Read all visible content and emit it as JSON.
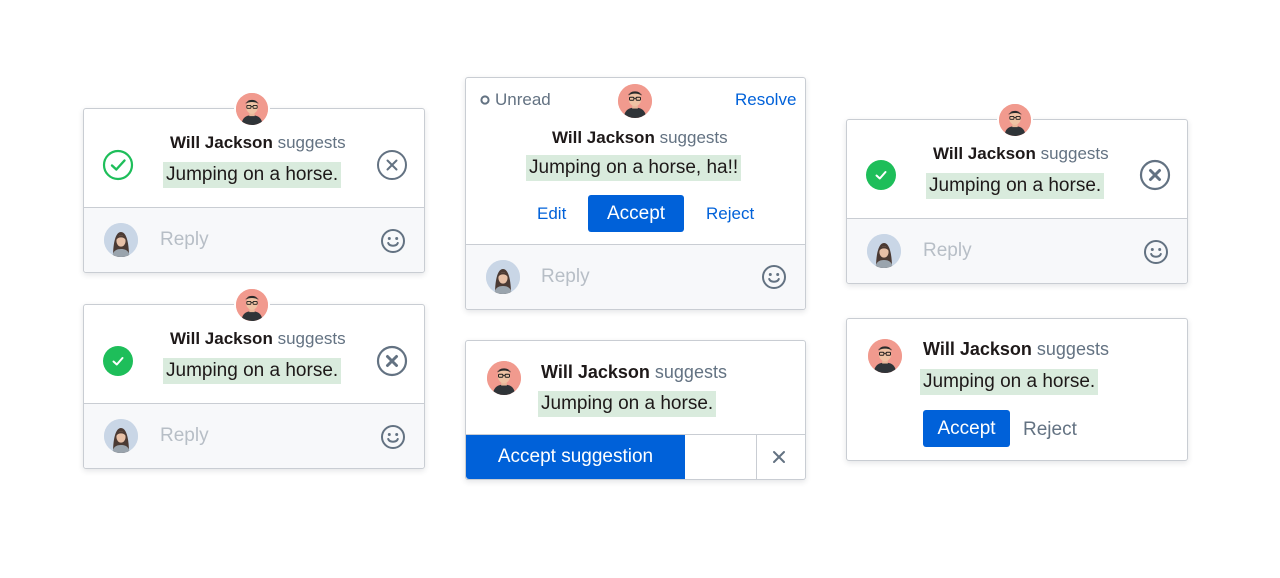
{
  "author": {
    "name": "Will Jackson",
    "verb": "suggests"
  },
  "suggestion": "Jumping on a horse.",
  "suggestion_alt": "Jumping on a horse, ha!!",
  "reply_placeholder": "Reply",
  "status": {
    "unread": "Unread",
    "resolve": "Resolve"
  },
  "actions": {
    "edit": "Edit",
    "accept": "Accept",
    "reject": "Reject",
    "accept_suggestion": "Accept suggestion"
  },
  "icons": {
    "check_outline": "check-circle-outline-icon",
    "check_filled": "check-circle-filled-icon",
    "close_circle": "close-circle-icon",
    "close": "close-icon",
    "emoji": "emoji-icon",
    "dot": "unread-dot-icon"
  },
  "colors": {
    "accent": "#0061d9",
    "success": "#1ebe5a",
    "highlight": "#d9ebdd",
    "muted": "#637282",
    "border": "#c9cdd3",
    "avatar_bg": "#f19a8e"
  }
}
